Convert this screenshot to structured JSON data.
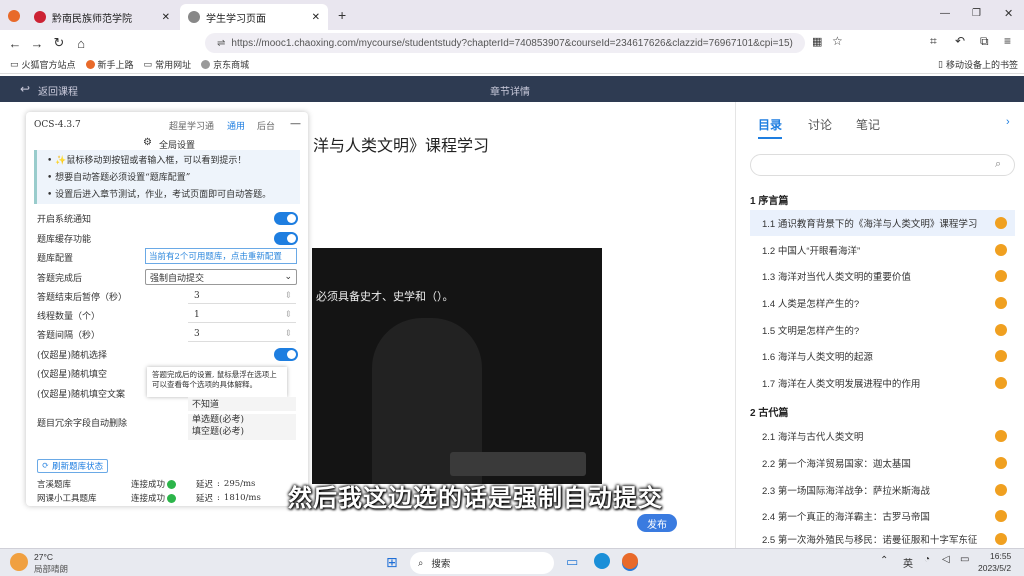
{
  "browser": {
    "tabs": [
      {
        "label": "黔南民族师范学院"
      },
      {
        "label": "学生学习页面"
      }
    ],
    "url": "https://mooc1.chaoxing.com/mycourse/studentstudy?chapterId=740853907&courseId=234617626&clazzid=76967101&cpi=15)",
    "bookmarks": [
      "火狐官方站点",
      "新手上路",
      "常用网址",
      "京东商城"
    ],
    "mobile_bookmarks": "移动设备上的书签"
  },
  "topnav": {
    "back": "返回课程",
    "title": "章节详情"
  },
  "main": {
    "course_title": "洋与人类文明》课程学习",
    "question_text": "必须具备史才、史学和（）。",
    "publish_button": "发布"
  },
  "panel": {
    "version": "OCS-4.3.7",
    "tabs": [
      "超星学习通",
      "通用",
      "后台"
    ],
    "settings_title": "全局设置",
    "tips": [
      "✨鼠标移动到按钮或者输入框，可以看到提示！",
      "想要自动答题必须设置“题库配置”",
      "设置后进入章节测试，作业，考试页面即可自动答题。"
    ],
    "rows": {
      "notify": "开启系统通知",
      "cache": "题库缓存功能",
      "config": "题库配置",
      "config_value": "当前有2个可用题库，点击重新配置",
      "after_label": "答题完成后",
      "after_value": "强制自动提交",
      "pause_label": "答题结束后暂停（秒）",
      "pause_value": "3",
      "thread_label": "线程数量（个）",
      "thread_value": "1",
      "interval_label": "答题间隔（秒）",
      "interval_value": "3",
      "random_select": "(仅超星)随机选择",
      "random_fill": "(仅超星)随机填空",
      "random_fill_text": "(仅超星)随机填空文案",
      "random_fill_text_value": "不知道",
      "redundant_label": "题目冗余字段自动删除",
      "redundant_values": [
        "单选题(必考)",
        "填空题(必考)"
      ]
    },
    "tooltip": "答题完成后的设置, 鼠标悬浮在选项上可以查看每个选项的具体解释。",
    "refresh_button": "刷新题库状态",
    "banks": [
      {
        "name": "言溪题库",
        "status": "连接成功",
        "latency_label": "延迟",
        "latency": "295/ms"
      },
      {
        "name": "网课小工具题库",
        "status": "连接成功",
        "latency_label": "延迟",
        "latency": "1810/ms"
      }
    ]
  },
  "sidebar": {
    "tabs": [
      "目录",
      "讨论",
      "笔记"
    ],
    "chapters": [
      {
        "title": "1 序言篇",
        "items": [
          "1.1 通识教育背景下的《海洋与人类文明》课程学习",
          "1.2 中国人“开眼看海洋”",
          "1.3 海洋对当代人类文明的重要价值",
          "1.4 人类是怎样产生的?",
          "1.5 文明是怎样产生的?",
          "1.6 海洋与人类文明的起源",
          "1.7 海洋在人类文明发展进程中的作用"
        ]
      },
      {
        "title": "2 古代篇",
        "items": [
          "2.1 海洋与古代人类文明",
          "2.2 第一个海洋贸易国家：迦太基国",
          "2.3 第一场国际海洋战争：萨拉米斯海战",
          "2.4 第一个真正的海洋霸主：古罗马帝国",
          "2.5 第一次海外殖民与移民：诺曼征服和十字军东征"
        ]
      }
    ]
  },
  "subtitle": "然后我这边选的话是强制自动提交",
  "taskbar": {
    "weather_temp": "27°C",
    "weather_text": "局部晴朗",
    "search": "搜索",
    "lang": "英",
    "time": "16:55",
    "date": "2023/5/2"
  },
  "colors": {
    "accent": "#1e7ee0",
    "nav": "#2e3b52",
    "orange": "#f0a020"
  }
}
